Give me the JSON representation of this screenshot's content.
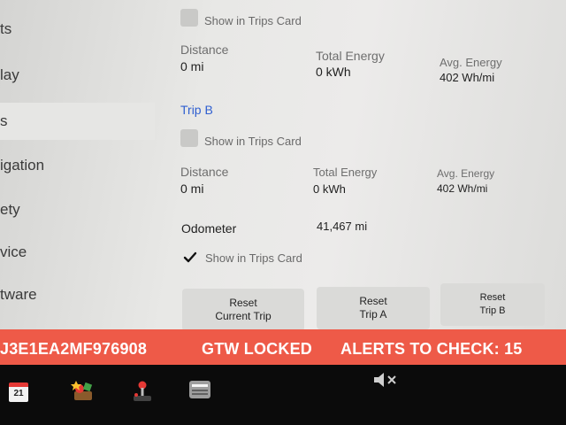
{
  "sidebar": {
    "items": [
      {
        "label": "ts"
      },
      {
        "label": "lay"
      },
      {
        "label": "s"
      },
      {
        "label": "igation"
      },
      {
        "label": "ety"
      },
      {
        "label": "vice"
      },
      {
        "label": "tware"
      }
    ]
  },
  "trip_a": {
    "show_in_trips_card": "Show in Trips Card",
    "distance_label": "Distance",
    "distance_value": "0 mi",
    "total_energy_label": "Total Energy",
    "total_energy_value": "0 kWh",
    "avg_energy_label": "Avg. Energy",
    "avg_energy_value": "402 Wh/mi"
  },
  "trip_b": {
    "title": "Trip B",
    "show_in_trips_card": "Show in Trips Card",
    "distance_label": "Distance",
    "distance_value": "0 mi",
    "total_energy_label": "Total Energy",
    "total_energy_value": "0 kWh",
    "avg_energy_label": "Avg. Energy",
    "avg_energy_value": "402 Wh/mi"
  },
  "odometer": {
    "label": "Odometer",
    "value": "41,467 mi",
    "show_in_trips_card": "Show in Trips Card",
    "checked": true
  },
  "buttons": {
    "reset_current_line1": "Reset",
    "reset_current_line2": "Current Trip",
    "reset_a_line1": "Reset",
    "reset_a_line2": "Trip A",
    "reset_b_line1": "Reset",
    "reset_b_line2": "Trip B"
  },
  "alert_bar": {
    "vin": "J3E1EA2MF976908",
    "gtw": "GTW LOCKED",
    "alerts": "ALERTS TO CHECK: 15",
    "color": "#ee5a48"
  },
  "taskbar": {
    "calendar_day": "21",
    "icons": [
      "calendar-icon",
      "toybox-icon",
      "joystick-icon",
      "dashcam-icon",
      "volume-muted-icon"
    ]
  },
  "colors": {
    "accent_blue": "#2f5fd0",
    "alert_red": "#ee5a48"
  }
}
